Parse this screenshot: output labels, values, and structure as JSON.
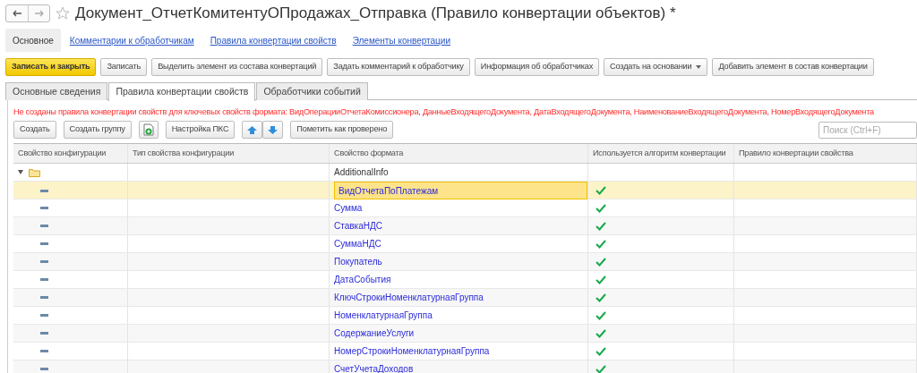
{
  "window": {
    "title": "Документ_ОтчетКомитентуОПродажах_Отправка (Правило конвертации объектов) *",
    "favorite": false
  },
  "page_nav": [
    {
      "label": "Основное",
      "selected": true
    },
    {
      "label": "Комментарии к обработчикам",
      "selected": false
    },
    {
      "label": "Правила конвертации свойств",
      "selected": false
    },
    {
      "label": "Элементы конвертации",
      "selected": false
    }
  ],
  "command_bar": [
    {
      "label": "Записать и закрыть",
      "kind": "primary"
    },
    {
      "label": "Записать",
      "kind": "plain"
    },
    {
      "label": "Выделить элемент из состава конвертаций",
      "kind": "plain"
    },
    {
      "label": "Задать комментарий к обработчику",
      "kind": "plain"
    },
    {
      "label": "Информация об обработчиках",
      "kind": "plain"
    },
    {
      "label": "Создать на основании",
      "kind": "dropdown"
    },
    {
      "label": "Добавить элемент в состав конвертации",
      "kind": "plain"
    }
  ],
  "tabs": [
    {
      "label": "Основные сведения",
      "selected": false
    },
    {
      "label": "Правила конвертации свойств",
      "selected": true
    },
    {
      "label": "Обработчики событий",
      "selected": false
    }
  ],
  "warning": "Не созданы правила конвертации свойств для ключевых свойств формата: ВидОперацииОтчетаКомиссионера, ДанныеВходящегоДокумента, ДатаВходящегоДокумента, НаименованиеВходящегоДокумента, НомерВходящегоДокумента",
  "toolbar": [
    {
      "kind": "text",
      "label": "Создать"
    },
    {
      "kind": "text",
      "label": "Создать группу"
    },
    {
      "kind": "add-file"
    },
    {
      "kind": "text",
      "label": "Настройка ПКС"
    },
    {
      "kind": "move"
    },
    {
      "kind": "text",
      "label": "Пометить как проверено"
    }
  ],
  "search": {
    "placeholder": "Поиск (Ctrl+F)"
  },
  "table": {
    "columns": [
      "Свойство конфигурации",
      "Тип свойства конфигурации",
      "Свойство формата",
      "Используется алгоритм конвертации",
      "Правило конвертации свойства"
    ],
    "rows": [
      {
        "kind": "folder",
        "expanded": true,
        "format_property": "AdditionalInfo",
        "algorithm_used": false,
        "selected": false
      },
      {
        "kind": "property",
        "format_property": "ВидОтчетаПоПлатежам",
        "algorithm_used": true,
        "selected": true
      },
      {
        "kind": "property",
        "format_property": "Сумма",
        "algorithm_used": true,
        "selected": false
      },
      {
        "kind": "property",
        "format_property": "СтавкаНДС",
        "algorithm_used": true,
        "selected": false
      },
      {
        "kind": "property",
        "format_property": "СуммаНДС",
        "algorithm_used": true,
        "selected": false
      },
      {
        "kind": "property",
        "format_property": "Покупатель",
        "algorithm_used": true,
        "selected": false
      },
      {
        "kind": "property",
        "format_property": "ДатаСобытия",
        "algorithm_used": true,
        "selected": false
      },
      {
        "kind": "property",
        "format_property": "КлючСтрокиНоменклатурнаяГруппа",
        "algorithm_used": true,
        "selected": false
      },
      {
        "kind": "property",
        "format_property": "НоменклатурнаяГруппа",
        "algorithm_used": true,
        "selected": false
      },
      {
        "kind": "property",
        "format_property": "СодержаниеУслуги",
        "algorithm_used": true,
        "selected": false
      },
      {
        "kind": "property",
        "format_property": "НомерСтрокиНоменклатурнаяГруппа",
        "algorithm_used": true,
        "selected": false
      },
      {
        "kind": "property",
        "format_property": "СчетУчетаДоходов",
        "algorithm_used": true,
        "selected": false
      }
    ]
  }
}
